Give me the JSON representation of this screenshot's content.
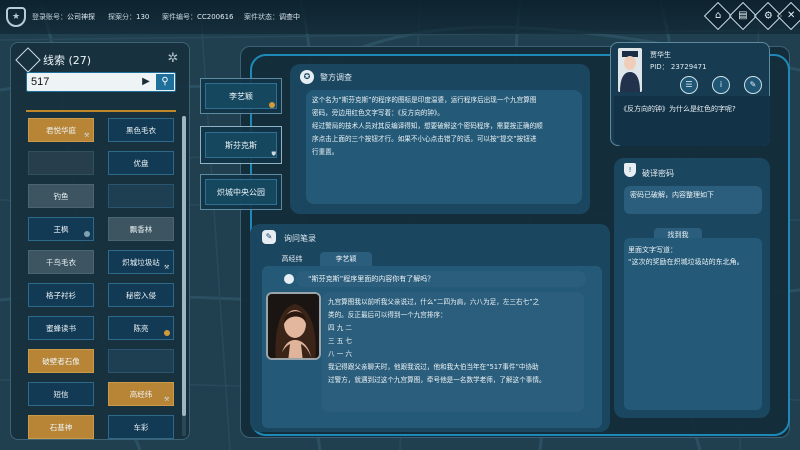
{
  "topbar": {
    "account_label": "登录账号：",
    "account_value": "公司神探",
    "score_label": "探案分：",
    "score_value": "130",
    "case_label": "案件编号：",
    "case_value": "CC200616",
    "status_label": "案件状态：",
    "status_value": "调查中",
    "buttons": [
      "home-icon",
      "map-icon",
      "gear-icon",
      "close-icon"
    ]
  },
  "clues": {
    "title": "线索 (27)",
    "search_value": "517",
    "items": [
      {
        "label": "君悦华庭",
        "style": "gold",
        "marker": "pin"
      },
      {
        "label": "黑色毛衣",
        "style": "blue",
        "marker": ""
      },
      {
        "label": "",
        "style": "empty",
        "marker": ""
      },
      {
        "label": "优盘",
        "style": "blue",
        "marker": ""
      },
      {
        "label": "钓鱼",
        "style": "gray",
        "marker": ""
      },
      {
        "label": "",
        "style": "empty",
        "marker": ""
      },
      {
        "label": "王枫",
        "style": "blue",
        "marker": "hollow"
      },
      {
        "label": "飘香林",
        "style": "gray",
        "marker": ""
      },
      {
        "label": "千鸟毛衣",
        "style": "gray",
        "marker": ""
      },
      {
        "label": "炽城垃圾站",
        "style": "blue",
        "marker": "pin"
      },
      {
        "label": "格子衬衫",
        "style": "blue",
        "marker": ""
      },
      {
        "label": "秘密入侵",
        "style": "blue",
        "marker": ""
      },
      {
        "label": "蜜蜂读书",
        "style": "blue",
        "marker": ""
      },
      {
        "label": "陈亮",
        "style": "blue",
        "marker": "gold"
      },
      {
        "label": "破壁者石像",
        "style": "gold",
        "marker": ""
      },
      {
        "label": "",
        "style": "empty",
        "marker": ""
      },
      {
        "label": "短信",
        "style": "blue",
        "marker": ""
      },
      {
        "label": "高经纬",
        "style": "gold",
        "marker": "pin"
      },
      {
        "label": "石基神",
        "style": "gold",
        "marker": ""
      },
      {
        "label": "车彩",
        "style": "blue",
        "marker": ""
      }
    ]
  },
  "tabs": [
    {
      "label": "李艺颖",
      "marker": "gold"
    },
    {
      "label": "斯芬克斯",
      "marker": "shield"
    },
    {
      "label": "炽城中央公园",
      "marker": ""
    }
  ],
  "police": {
    "title": "警方调查",
    "lines": [
      "这个名为“斯芬克斯”的程序的图标是印度温婆，运行程序后出现一个九宫算图",
      "密码，旁边用红色文字写着：《反方向的钟》。",
      "经过警局的技术人员对其反编译得知，想要破解这个密码程序，需要按正确的顺",
      "序点击上面的三个按钮才行。如果不小心点击错了的话，可以按“提交”按钮进",
      "行重置。"
    ]
  },
  "interrogation": {
    "title": "询问笔录",
    "tabs": [
      "高经纬",
      "李艺颖"
    ],
    "active_tab": 1,
    "question": "“斯芬克斯”程序里面的内容你有了解吗？",
    "answer": [
      "九宫算图我以前听我父亲说过，什么“二四为肩，六八为足，左三右七”之",
      "类的。反正最后可以得到一个九宫排序：",
      "四 九 二",
      "三 五 七",
      "八 一 六",
      "我记得跟父亲聊天时，他跟我说过，他和我大伯当年在“517事件”中协助",
      "过警方，就遇到过这个九宫算图，牵号他是一名数学老师，了解这个事情。"
    ]
  },
  "profile": {
    "name": "贾华生",
    "pid": "PID： 23729471",
    "buttons": [
      "chat-icon",
      "info-icon",
      "note-icon"
    ],
    "question": "《反方向的钟》为什么是红色的字呢?"
  },
  "decode": {
    "title": "破译密码",
    "status": "密码已破解，内容整理如下",
    "found_tab": "找到我",
    "found_lines": [
      "里面文字写道：",
      "“这次的奖励在炽城垃圾站的东北角。"
    ]
  }
}
